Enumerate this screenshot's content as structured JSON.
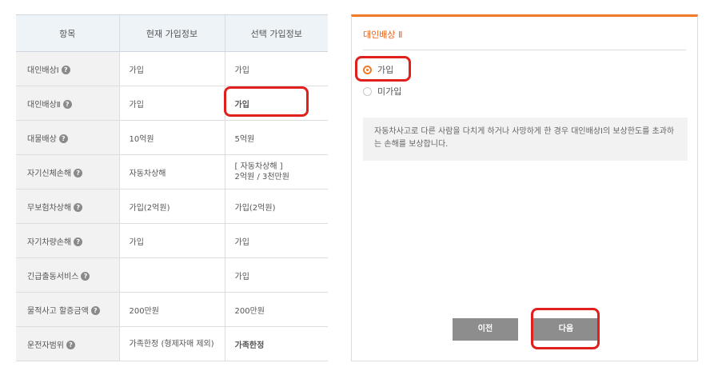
{
  "table": {
    "headers": [
      "항목",
      "현재 가입정보",
      "선택 가입정보"
    ],
    "rows": [
      {
        "label": "대인배상Ⅰ",
        "current": "가입",
        "selected": "가입"
      },
      {
        "label": "대인배상Ⅱ",
        "current": "가입",
        "selected": "가입"
      },
      {
        "label": "대물배상",
        "current": "10억원",
        "selected": "5억원"
      },
      {
        "label": "자기신체손해",
        "current": "자동차상해",
        "selected": "[ 자동차상해 ]\n2억원 / 3천만원"
      },
      {
        "label": "무보험차상해",
        "current": "가입(2억원)",
        "selected": "가입(2억원)"
      },
      {
        "label": "자기차량손해",
        "current": "가입",
        "selected": "가입"
      },
      {
        "label": "긴급출동서비스",
        "current": "",
        "selected": "가입"
      },
      {
        "label": "물적사고 할증금액",
        "current": "200만원",
        "selected": "200만원"
      },
      {
        "label": "운전자범위",
        "current": "가족한정 (형제자매 제외)",
        "selected": "가족한정"
      }
    ],
    "help_glyph": "?"
  },
  "panel": {
    "title": "대인배상 Ⅱ",
    "options": [
      "가입",
      "미가입"
    ],
    "selected_option": "가입",
    "description": "자동차사고로 다른 사람을 다치게 하거나 사망하게 한 경우 대인배상Ⅰ의 보상한도를 초과하는 손해를 보상합니다.",
    "prev_label": "이전",
    "next_label": "다음"
  },
  "colors": {
    "accent": "#f07a27",
    "highlight_box": "#e0201d",
    "button": "#8d8d8d"
  }
}
